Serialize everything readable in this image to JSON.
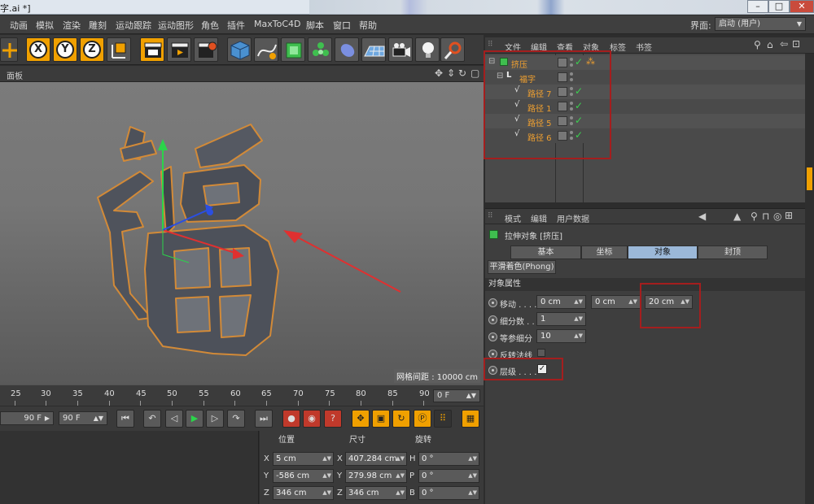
{
  "window": {
    "title": "字.ai *]",
    "controls": [
      "–",
      "□",
      "✕"
    ]
  },
  "menu": {
    "items": [
      "动画",
      "模拟",
      "渲染",
      "雕刻",
      "运动跟踪",
      "运动图形",
      "角色",
      "插件",
      "MaxToC4D",
      "脚本",
      "窗口",
      "帮助"
    ],
    "layout_label": "界面:",
    "layout_value": "启动 (用户)"
  },
  "toolbar": {
    "axes": [
      "X",
      "Y",
      "Z"
    ]
  },
  "viewport": {
    "panel_label": "面板",
    "grid_spacing": "网格间距 : 10000 cm"
  },
  "timeline": {
    "ticks": [
      "25",
      "30",
      "35",
      "40",
      "45",
      "50",
      "55",
      "60",
      "65",
      "70",
      "75",
      "80",
      "85",
      "90"
    ],
    "current_frame": "0 F",
    "end_frame_a": "90 F",
    "end_frame_b": "90 F"
  },
  "coords": {
    "headers": {
      "position": "位置",
      "size": "尺寸",
      "rotation": "旋转"
    },
    "rows": [
      {
        "axis": "X",
        "pos": "5 cm",
        "size_axis": "X",
        "size": "407.284 cm",
        "rot_axis": "H",
        "rot": "0 °"
      },
      {
        "axis": "Y",
        "pos": "-586 cm",
        "size_axis": "Y",
        "size": "279.98 cm",
        "rot_axis": "P",
        "rot": "0 °"
      },
      {
        "axis": "Z",
        "pos": "346 cm",
        "size_axis": "Z",
        "size": "346 cm",
        "rot_axis": "B",
        "rot": "0 °"
      }
    ]
  },
  "object_manager": {
    "menu": [
      "文件",
      "编辑",
      "查看",
      "对象",
      "标签",
      "书签"
    ],
    "objects": [
      {
        "name": "挤压",
        "check": "✓"
      },
      {
        "name": "福字",
        "check": ""
      },
      {
        "name": "路径 7",
        "check": "✓"
      },
      {
        "name": "路径 1",
        "check": "✓"
      },
      {
        "name": "路径 5",
        "check": "✓"
      },
      {
        "name": "路径 6",
        "check": "✓"
      }
    ]
  },
  "attributes": {
    "menu": [
      "模式",
      "编辑",
      "用户数据"
    ],
    "object_title": "拉伸对象 [挤压]",
    "tabs": [
      "基本",
      "坐标",
      "对象",
      "封顶"
    ],
    "tab_phong": "平滑着色(Phong)",
    "section": "对象属性",
    "labels": {
      "move": "移动 . . . .",
      "subdiv": "细分数 . .",
      "iso": "等参细分",
      "flip": "反转法线",
      "hierarchy": "层级 . . . ."
    },
    "values": {
      "move_x": "0 cm",
      "move_y": "0 cm",
      "move_z": "20 cm",
      "subdiv": "1",
      "iso": "10"
    }
  }
}
